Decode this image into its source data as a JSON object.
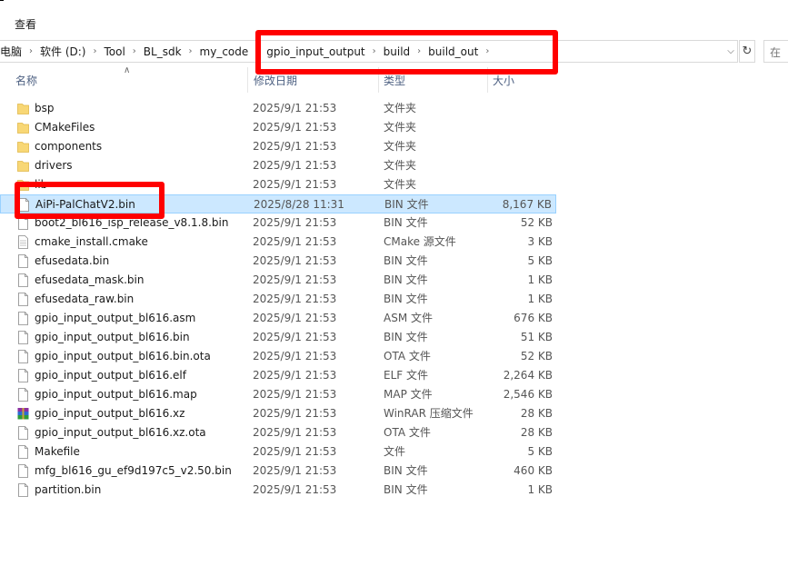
{
  "menu": {
    "view": "查看"
  },
  "address": {
    "crumbs": [
      "电脑",
      "软件 (D:)",
      "Tool",
      "BL_sdk",
      "my_code",
      "gpio_input_output",
      "build",
      "build_out"
    ]
  },
  "search": {
    "placeholder": "在"
  },
  "columns": {
    "name": "名称",
    "date": "修改日期",
    "type": "类型",
    "size": "大小"
  },
  "files": [
    {
      "name": "bsp",
      "date": "2025/9/1 21:53",
      "type": "文件夹",
      "size": "",
      "icon": "folder-icon"
    },
    {
      "name": "CMakeFiles",
      "date": "2025/9/1 21:53",
      "type": "文件夹",
      "size": "",
      "icon": "folder-icon"
    },
    {
      "name": "components",
      "date": "2025/9/1 21:53",
      "type": "文件夹",
      "size": "",
      "icon": "folder-icon"
    },
    {
      "name": "drivers",
      "date": "2025/9/1 21:53",
      "type": "文件夹",
      "size": "",
      "icon": "folder-icon"
    },
    {
      "name": "lib",
      "date": "2025/9/1 21:53",
      "type": "文件夹",
      "size": "",
      "icon": "folder-icon"
    },
    {
      "name": "AiPi-PalChatV2.bin",
      "date": "2025/8/28 11:31",
      "type": "BIN 文件",
      "size": "8,167 KB",
      "icon": "file-icon",
      "selected": true
    },
    {
      "name": "boot2_bl616_isp_release_v8.1.8.bin",
      "date": "2025/9/1 21:53",
      "type": "BIN 文件",
      "size": "52 KB",
      "icon": "file-icon"
    },
    {
      "name": "cmake_install.cmake",
      "date": "2025/9/1 21:53",
      "type": "CMake 源文件",
      "size": "3 KB",
      "icon": "text-file-icon"
    },
    {
      "name": "efusedata.bin",
      "date": "2025/9/1 21:53",
      "type": "BIN 文件",
      "size": "5 KB",
      "icon": "file-icon"
    },
    {
      "name": "efusedata_mask.bin",
      "date": "2025/9/1 21:53",
      "type": "BIN 文件",
      "size": "1 KB",
      "icon": "file-icon"
    },
    {
      "name": "efusedata_raw.bin",
      "date": "2025/9/1 21:53",
      "type": "BIN 文件",
      "size": "1 KB",
      "icon": "file-icon"
    },
    {
      "name": "gpio_input_output_bl616.asm",
      "date": "2025/9/1 21:53",
      "type": "ASM 文件",
      "size": "676 KB",
      "icon": "file-icon"
    },
    {
      "name": "gpio_input_output_bl616.bin",
      "date": "2025/9/1 21:53",
      "type": "BIN 文件",
      "size": "51 KB",
      "icon": "file-icon"
    },
    {
      "name": "gpio_input_output_bl616.bin.ota",
      "date": "2025/9/1 21:53",
      "type": "OTA 文件",
      "size": "52 KB",
      "icon": "file-icon"
    },
    {
      "name": "gpio_input_output_bl616.elf",
      "date": "2025/9/1 21:53",
      "type": "ELF 文件",
      "size": "2,264 KB",
      "icon": "file-icon"
    },
    {
      "name": "gpio_input_output_bl616.map",
      "date": "2025/9/1 21:53",
      "type": "MAP 文件",
      "size": "2,546 KB",
      "icon": "file-icon"
    },
    {
      "name": "gpio_input_output_bl616.xz",
      "date": "2025/9/1 21:53",
      "type": "WinRAR 压缩文件",
      "size": "28 KB",
      "icon": "winrar-icon"
    },
    {
      "name": "gpio_input_output_bl616.xz.ota",
      "date": "2025/9/1 21:53",
      "type": "OTA 文件",
      "size": "28 KB",
      "icon": "file-icon"
    },
    {
      "name": "Makefile",
      "date": "2025/9/1 21:53",
      "type": "文件",
      "size": "5 KB",
      "icon": "file-icon"
    },
    {
      "name": "mfg_bl616_gu_ef9d197c5_v2.50.bin",
      "date": "2025/9/1 21:53",
      "type": "BIN 文件",
      "size": "460 KB",
      "icon": "file-icon"
    },
    {
      "name": "partition.bin",
      "date": "2025/9/1 21:53",
      "type": "BIN 文件",
      "size": "1 KB",
      "icon": "file-icon"
    }
  ],
  "colors": {
    "highlight": "#ff0000",
    "selection": "#cce8ff",
    "folder": "#f8d775",
    "header_text": "#4d6082"
  }
}
